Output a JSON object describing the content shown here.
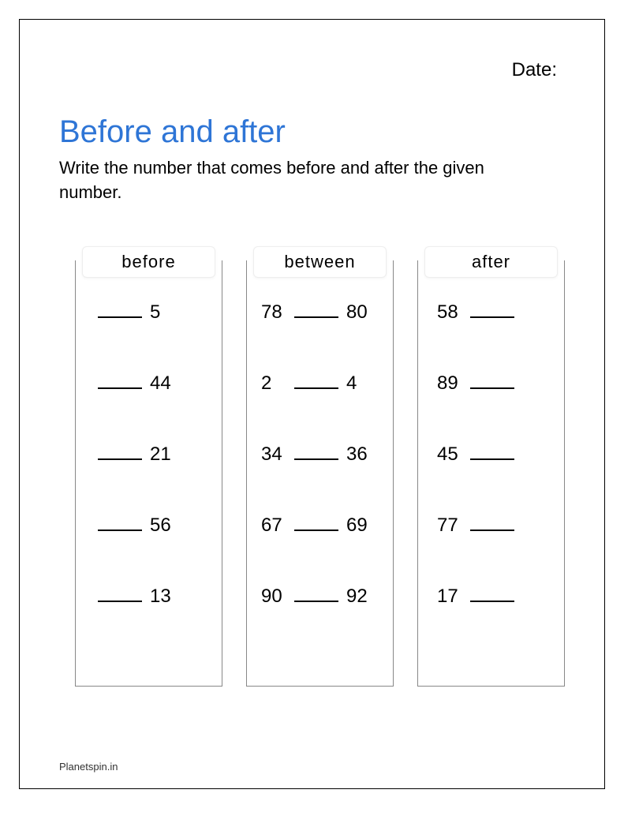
{
  "date_label": "Date:",
  "title": "Before and after",
  "instructions": "Write the number that comes before and after the given number.",
  "columns": {
    "before": {
      "header": "before",
      "items": [
        "5",
        "44",
        "21",
        "56",
        "13"
      ]
    },
    "between": {
      "header": "between",
      "items": [
        {
          "left": "78",
          "right": "80"
        },
        {
          "left": "2",
          "right": "4"
        },
        {
          "left": "34",
          "right": "36"
        },
        {
          "left": "67",
          "right": "69"
        },
        {
          "left": "90",
          "right": "92"
        }
      ]
    },
    "after": {
      "header": "after",
      "items": [
        "58",
        "89",
        "45",
        "77",
        "17"
      ]
    }
  },
  "footer": "Planetspin.in"
}
